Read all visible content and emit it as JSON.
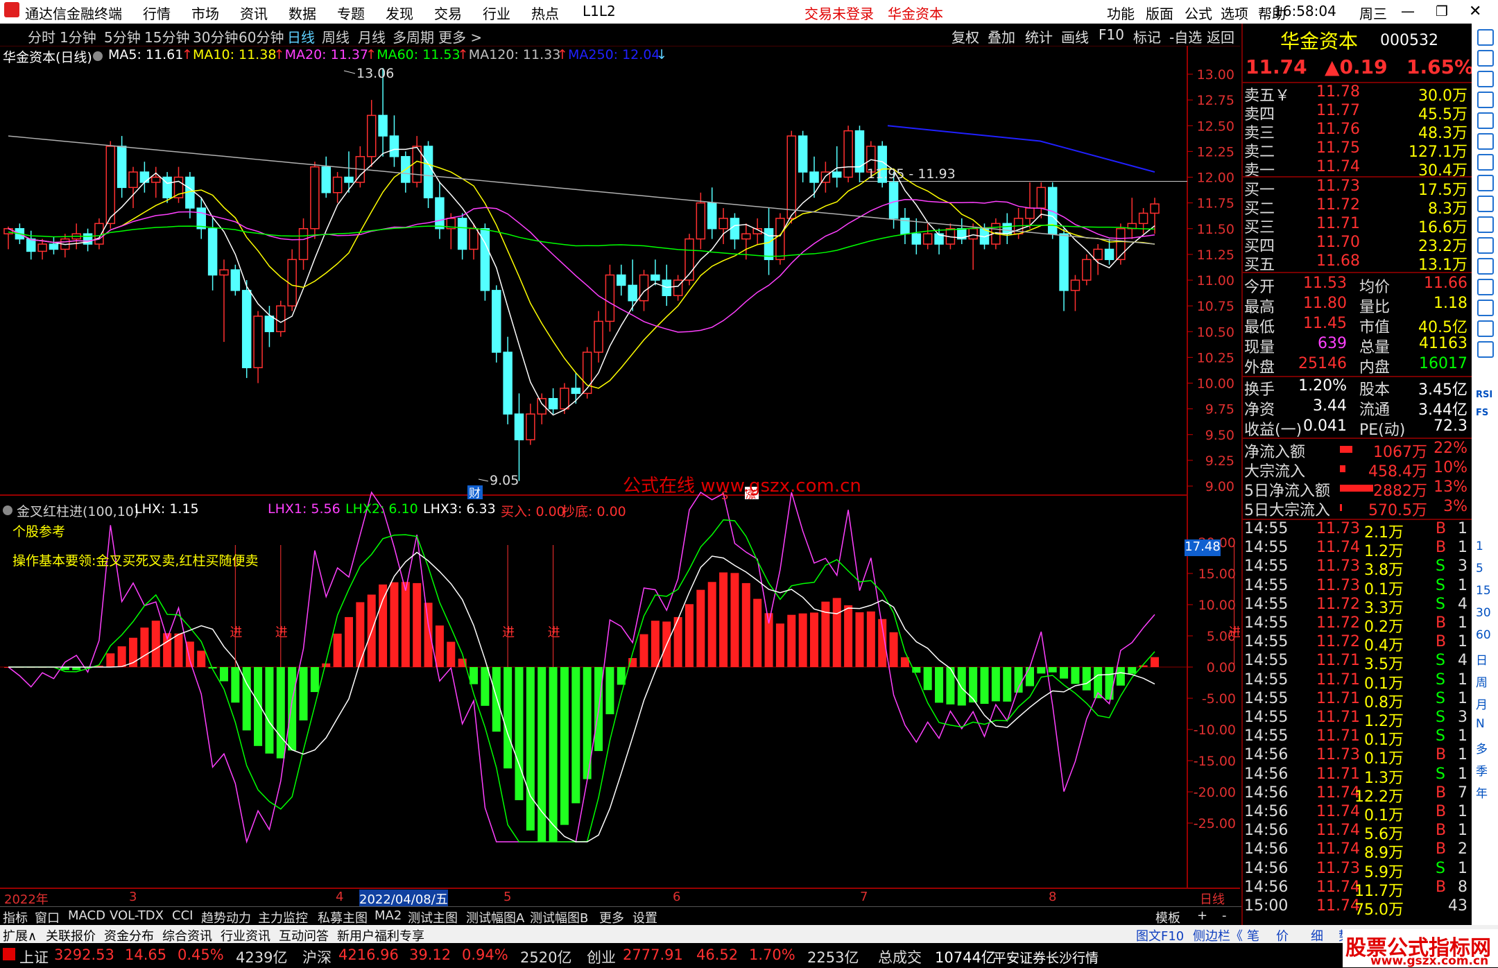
{
  "app": {
    "name": "通达信金融终端",
    "menu": [
      "行情",
      "市场",
      "资讯",
      "数据",
      "专题",
      "发现",
      "交易",
      "行业",
      "热点",
      "L1L2"
    ],
    "status_login": "交易未登录",
    "status_stock": "华金资本",
    "right_menu": [
      "功能",
      "版面",
      "公式",
      "选项",
      "帮助"
    ],
    "time": "16:58:04",
    "weekday": "周三"
  },
  "periods": [
    "分时",
    "1分钟",
    "5分钟",
    "15分钟",
    "30分钟",
    "60分钟",
    "日线",
    "周线",
    "月线",
    "多周期",
    "更多 >"
  ],
  "selected_period": "日线",
  "toolbar": [
    "复权",
    "叠加",
    "统计",
    "画线",
    "F10",
    "标记",
    "-自选",
    "返回"
  ],
  "main_chart": {
    "title": "华金资本(日线)",
    "ma": [
      {
        "label": "MA5: 11.61",
        "color": "#ffffff"
      },
      {
        "label": "MA10: 11.38",
        "color": "#ffff00"
      },
      {
        "label": "MA20: 11.37",
        "color": "#ff40ff"
      },
      {
        "label": "MA60: 11.53",
        "color": "#00ff00"
      },
      {
        "label": "MA120: 11.33",
        "color": "#c0c0c0"
      },
      {
        "label": "MA250: 12.04",
        "color": "#2020ff"
      }
    ],
    "high_label": "13.06",
    "low_label": "9.05",
    "range_label": "11.95 - 11.93",
    "watermark": "公式在线  www.gszx.com.cn",
    "markers": [
      "财",
      "S",
      "涨"
    ],
    "y_ticks": [
      "13.00",
      "12.75",
      "12.50",
      "12.25",
      "12.00",
      "11.75",
      "11.50",
      "11.25",
      "11.00",
      "10.75",
      "10.50",
      "10.25",
      "10.00",
      "9.75",
      "9.50",
      "9.25",
      "9.00"
    ]
  },
  "chart_data": {
    "type": "candlestick",
    "price_range": [
      9.0,
      13.06
    ],
    "candles": [
      [
        11.45,
        11.52,
        11.3,
        11.5
      ],
      [
        11.5,
        11.55,
        11.35,
        11.4
      ],
      [
        11.4,
        11.48,
        11.2,
        11.28
      ],
      [
        11.28,
        11.4,
        11.2,
        11.35
      ],
      [
        11.35,
        11.42,
        11.25,
        11.3
      ],
      [
        11.3,
        11.45,
        11.22,
        11.4
      ],
      [
        11.4,
        11.55,
        11.3,
        11.45
      ],
      [
        11.45,
        11.5,
        11.28,
        11.35
      ],
      [
        11.35,
        11.6,
        11.3,
        11.55
      ],
      [
        11.55,
        12.35,
        11.5,
        12.3
      ],
      [
        12.3,
        12.4,
        11.8,
        11.9
      ],
      [
        11.9,
        12.1,
        11.7,
        12.05
      ],
      [
        12.05,
        12.15,
        11.85,
        11.95
      ],
      [
        11.95,
        12.1,
        11.8,
        12.0
      ],
      [
        12.0,
        12.05,
        11.75,
        11.8
      ],
      [
        11.8,
        12.1,
        11.75,
        12.0
      ],
      [
        12.0,
        12.05,
        11.6,
        11.7
      ],
      [
        11.7,
        11.8,
        11.4,
        11.5
      ],
      [
        11.5,
        11.6,
        10.9,
        11.05
      ],
      [
        11.05,
        11.2,
        10.4,
        11.1
      ],
      [
        11.1,
        11.15,
        10.85,
        10.9
      ],
      [
        10.9,
        11.0,
        10.05,
        10.15
      ],
      [
        10.15,
        10.7,
        10.0,
        10.65
      ],
      [
        10.65,
        10.75,
        10.35,
        10.5
      ],
      [
        10.5,
        10.8,
        10.45,
        10.75
      ],
      [
        10.75,
        11.3,
        10.7,
        11.2
      ],
      [
        11.2,
        11.6,
        11.1,
        11.5
      ],
      [
        11.5,
        12.15,
        11.4,
        12.1
      ],
      [
        12.1,
        12.2,
        11.8,
        11.85
      ],
      [
        11.85,
        12.05,
        11.75,
        12.0
      ],
      [
        12.0,
        12.25,
        11.85,
        11.95
      ],
      [
        11.95,
        12.3,
        11.9,
        12.2
      ],
      [
        12.2,
        12.75,
        12.1,
        12.6
      ],
      [
        12.6,
        13.06,
        12.2,
        12.4
      ],
      [
        12.4,
        12.6,
        12.1,
        12.2
      ],
      [
        12.2,
        12.25,
        11.85,
        11.95
      ],
      [
        11.95,
        12.4,
        11.9,
        12.3
      ],
      [
        12.3,
        12.35,
        11.7,
        11.8
      ],
      [
        11.8,
        11.95,
        11.4,
        11.5
      ],
      [
        11.5,
        11.65,
        11.3,
        11.6
      ],
      [
        11.6,
        11.65,
        11.2,
        11.3
      ],
      [
        11.3,
        11.55,
        11.2,
        11.5
      ],
      [
        11.5,
        11.55,
        10.8,
        10.9
      ],
      [
        10.9,
        10.95,
        10.2,
        10.3
      ],
      [
        10.3,
        10.45,
        9.6,
        9.7
      ],
      [
        9.7,
        9.9,
        9.05,
        9.45
      ],
      [
        9.45,
        9.8,
        9.4,
        9.7
      ],
      [
        9.7,
        9.9,
        9.6,
        9.85
      ],
      [
        9.85,
        9.95,
        9.7,
        9.75
      ],
      [
        9.75,
        10.0,
        9.7,
        9.95
      ],
      [
        9.95,
        10.1,
        9.8,
        9.9
      ],
      [
        9.9,
        10.35,
        9.85,
        10.3
      ],
      [
        10.3,
        10.7,
        10.2,
        10.6
      ],
      [
        10.6,
        11.15,
        10.5,
        11.05
      ],
      [
        11.05,
        11.15,
        10.85,
        10.95
      ],
      [
        10.95,
        11.2,
        10.7,
        10.8
      ],
      [
        10.8,
        11.1,
        10.7,
        11.05
      ],
      [
        11.05,
        11.2,
        10.95,
        11.0
      ],
      [
        11.0,
        11.15,
        10.75,
        10.85
      ],
      [
        10.85,
        11.05,
        10.8,
        11.0
      ],
      [
        11.0,
        11.45,
        10.95,
        11.4
      ],
      [
        11.4,
        11.85,
        11.3,
        11.75
      ],
      [
        11.75,
        11.9,
        11.4,
        11.5
      ],
      [
        11.5,
        11.7,
        11.35,
        11.6
      ],
      [
        11.6,
        11.65,
        11.3,
        11.4
      ],
      [
        11.4,
        11.55,
        11.2,
        11.45
      ],
      [
        11.45,
        11.6,
        11.35,
        11.5
      ],
      [
        11.5,
        11.7,
        11.05,
        11.2
      ],
      [
        11.2,
        11.65,
        11.15,
        11.6
      ],
      [
        11.6,
        12.45,
        11.55,
        12.4
      ],
      [
        12.4,
        12.45,
        11.95,
        12.05
      ],
      [
        12.05,
        12.2,
        11.8,
        11.95
      ],
      [
        11.95,
        12.15,
        11.85,
        12.05
      ],
      [
        12.05,
        12.3,
        11.9,
        12.0
      ],
      [
        12.0,
        12.5,
        11.95,
        12.45
      ],
      [
        12.45,
        12.5,
        11.95,
        12.05
      ],
      [
        12.05,
        12.35,
        12.0,
        12.3
      ],
      [
        12.3,
        12.35,
        11.9,
        11.95
      ],
      [
        11.95,
        12.05,
        11.5,
        11.6
      ],
      [
        11.6,
        11.7,
        11.35,
        11.45
      ],
      [
        11.45,
        11.6,
        11.25,
        11.35
      ],
      [
        11.35,
        11.55,
        11.3,
        11.45
      ],
      [
        11.45,
        11.5,
        11.25,
        11.35
      ],
      [
        11.35,
        11.55,
        11.3,
        11.5
      ],
      [
        11.5,
        11.6,
        11.35,
        11.4
      ],
      [
        11.4,
        11.55,
        11.1,
        11.5
      ],
      [
        11.5,
        11.55,
        11.3,
        11.35
      ],
      [
        11.35,
        11.6,
        11.3,
        11.55
      ],
      [
        11.55,
        11.65,
        11.35,
        11.45
      ],
      [
        11.45,
        11.7,
        11.4,
        11.6
      ],
      [
        11.6,
        11.95,
        11.5,
        11.7
      ],
      [
        11.7,
        11.95,
        11.6,
        11.9
      ],
      [
        11.9,
        11.95,
        11.4,
        11.45
      ],
      [
        11.45,
        11.5,
        10.7,
        10.9
      ],
      [
        10.9,
        11.05,
        10.7,
        11.0
      ],
      [
        11.0,
        11.25,
        10.95,
        11.2
      ],
      [
        11.2,
        11.35,
        11.05,
        11.3
      ],
      [
        11.3,
        11.4,
        11.15,
        11.2
      ],
      [
        11.2,
        11.55,
        11.15,
        11.5
      ],
      [
        11.5,
        11.8,
        11.4,
        11.55
      ],
      [
        11.55,
        11.7,
        11.45,
        11.65
      ],
      [
        11.65,
        11.8,
        11.45,
        11.74
      ]
    ],
    "x_axis": [
      "2022年",
      "3",
      "4",
      "2022/04/08/五",
      "5",
      "6",
      "7",
      "8",
      "日线"
    ]
  },
  "indicator": {
    "title": "金叉红柱进(100,10)",
    "lhx": "LHX: 1.15",
    "lhx1": "LHX1: 5.56",
    "lhx2": "LHX2: 6.10",
    "lhx3": "LHX3: 6.33",
    "buy": "买入: 0.00",
    "bottom": "抄底: 0.00",
    "note1": "个股参考",
    "note2": "操作基本要领:金叉买死叉卖,红柱买随便卖",
    "current_value": "17.48",
    "buy_label": "进",
    "y_ticks": [
      "20.00",
      "15.00",
      "10.00",
      "5.00",
      "0.00",
      "-5.00",
      "-10.00",
      "-15.00",
      "-20.00",
      "-25.00"
    ]
  },
  "bottom_tabs1": [
    "指标",
    "窗口",
    "MACD",
    "VOL-TDX",
    "CCI",
    "趋势动力",
    "主力监控",
    "私募主图",
    "MA2",
    "测试主图",
    "测试幅图A",
    "测试幅图B",
    "更多",
    "设置"
  ],
  "bottom_tabs1_right": [
    "模板",
    "+",
    "-"
  ],
  "bottom_tabs2": [
    "扩展∧",
    "关联报价",
    "资金分布",
    "综合资讯",
    "行业资讯",
    "互动问答",
    "新用户福利专享"
  ],
  "bottom_tabs2_right": [
    "图文F10",
    "侧边栏《",
    "笔",
    "价",
    "细",
    "势"
  ],
  "index_bar": {
    "sh_label": "上证",
    "sh": "3292.53",
    "sh_chg": "14.65",
    "sh_pct": "0.45%",
    "sh_amt": "4239亿",
    "hs_label": "沪深",
    "hs": "4216.96",
    "hs_chg": "39.12",
    "hs_pct": "0.94%",
    "hs_amt": "2520亿",
    "cy_label": "创业",
    "cy": "2777.91",
    "cy_chg": "46.52",
    "cy_pct": "1.70%",
    "cy_amt": "2253亿",
    "total_label": "总成交",
    "total": "10744亿",
    "broker": "平安证券长沙行情"
  },
  "logo": {
    "title": "股票公式指标网",
    "url": "www.gszx.com.cn"
  },
  "quote": {
    "name": "华金资本",
    "code": "000532",
    "price": "11.74",
    "change": "▲0.19",
    "pct": "1.65%",
    "asks": [
      {
        "label": "卖五￥",
        "price": "11.78",
        "vol": "30.0万"
      },
      {
        "label": "卖四",
        "price": "11.77",
        "vol": "45.5万"
      },
      {
        "label": "卖三",
        "price": "11.76",
        "vol": "48.3万"
      },
      {
        "label": "卖二",
        "price": "11.75",
        "vol": "127.1万"
      },
      {
        "label": "卖一",
        "price": "11.74",
        "vol": "30.4万"
      }
    ],
    "bids": [
      {
        "label": "买一",
        "price": "11.73",
        "vol": "17.5万"
      },
      {
        "label": "买二",
        "price": "11.72",
        "vol": "8.3万"
      },
      {
        "label": "买三",
        "price": "11.71",
        "vol": "16.6万"
      },
      {
        "label": "买四",
        "price": "11.70",
        "vol": "23.2万"
      },
      {
        "label": "买五",
        "price": "11.68",
        "vol": "13.1万"
      }
    ],
    "stats1": [
      {
        "l1": "今开",
        "v1": "11.53",
        "l2": "均价",
        "v2": "11.66"
      },
      {
        "l1": "最高",
        "v1": "11.80",
        "l2": "量比",
        "v2": "1.18"
      },
      {
        "l1": "最低",
        "v1": "11.45",
        "l2": "市值",
        "v2": "40.5亿"
      },
      {
        "l1": "现量",
        "v1": "639",
        "l2": "总量",
        "v2": "41163"
      },
      {
        "l1": "外盘",
        "v1": "25146",
        "l2": "内盘",
        "v2": "16017"
      }
    ],
    "stats2": [
      {
        "l1": "换手",
        "v1": "1.20%",
        "l2": "股本",
        "v2": "3.45亿"
      },
      {
        "l1": "净资",
        "v1": "3.44",
        "l2": "流通",
        "v2": "3.44亿"
      },
      {
        "l1": "收益(一)",
        "v1": "0.041",
        "l2": "PE(动)",
        "v2": "72.3"
      }
    ],
    "flows": [
      {
        "label": "净流入额",
        "val": "1067万",
        "pct": "22%",
        "bar": 0.22
      },
      {
        "label": "大宗流入",
        "val": "458.4万",
        "pct": "10%",
        "bar": 0.1
      },
      {
        "label": "5日净流入额",
        "val": "2882万",
        "pct": "13%",
        "bar": 0.6
      },
      {
        "label": "5日大宗流入",
        "val": "570.5万",
        "pct": "3%",
        "bar": 0.03
      }
    ],
    "ticks": [
      {
        "t": "14:55",
        "p": "11.73",
        "v": "2.1万",
        "s": "B",
        "n": "1"
      },
      {
        "t": "14:55",
        "p": "11.74",
        "v": "1.2万",
        "s": "B",
        "n": "1"
      },
      {
        "t": "14:55",
        "p": "11.73",
        "v": "3.8万",
        "s": "S",
        "n": "3"
      },
      {
        "t": "14:55",
        "p": "11.73",
        "v": "0.1万",
        "s": "S",
        "n": "1"
      },
      {
        "t": "14:55",
        "p": "11.72",
        "v": "3.3万",
        "s": "S",
        "n": "4"
      },
      {
        "t": "14:55",
        "p": "11.72",
        "v": "0.2万",
        "s": "B",
        "n": "1"
      },
      {
        "t": "14:55",
        "p": "11.72",
        "v": "0.4万",
        "s": "B",
        "n": "1"
      },
      {
        "t": "14:55",
        "p": "11.71",
        "v": "3.5万",
        "s": "S",
        "n": "4"
      },
      {
        "t": "14:55",
        "p": "11.71",
        "v": "0.1万",
        "s": "S",
        "n": "1"
      },
      {
        "t": "14:55",
        "p": "11.71",
        "v": "0.8万",
        "s": "S",
        "n": "1"
      },
      {
        "t": "14:55",
        "p": "11.71",
        "v": "1.2万",
        "s": "S",
        "n": "3"
      },
      {
        "t": "14:55",
        "p": "11.71",
        "v": "0.1万",
        "s": "S",
        "n": "1"
      },
      {
        "t": "14:56",
        "p": "11.73",
        "v": "0.1万",
        "s": "B",
        "n": "1"
      },
      {
        "t": "14:56",
        "p": "11.71",
        "v": "1.3万",
        "s": "S",
        "n": "1"
      },
      {
        "t": "14:56",
        "p": "11.74",
        "v": "12.2万",
        "s": "B",
        "n": "7"
      },
      {
        "t": "14:56",
        "p": "11.74",
        "v": "0.1万",
        "s": "B",
        "n": "1"
      },
      {
        "t": "14:56",
        "p": "11.74",
        "v": "5.6万",
        "s": "B",
        "n": "1"
      },
      {
        "t": "14:56",
        "p": "11.74",
        "v": "8.9万",
        "s": "B",
        "n": "2"
      },
      {
        "t": "14:56",
        "p": "11.73",
        "v": "5.9万",
        "s": "S",
        "n": "1"
      },
      {
        "t": "14:56",
        "p": "11.74",
        "v": "11.7万",
        "s": "B",
        "n": "8"
      },
      {
        "t": "15:00",
        "p": "11.74",
        "v": "75.0万",
        "s": "",
        "n": "43"
      }
    ]
  },
  "side_tools": [
    "1",
    "5",
    "15",
    "30",
    "60",
    "日",
    "周",
    "月",
    "N",
    "多",
    "季",
    "年"
  ],
  "side_tools_extra": [
    "RSI",
    "FS"
  ]
}
